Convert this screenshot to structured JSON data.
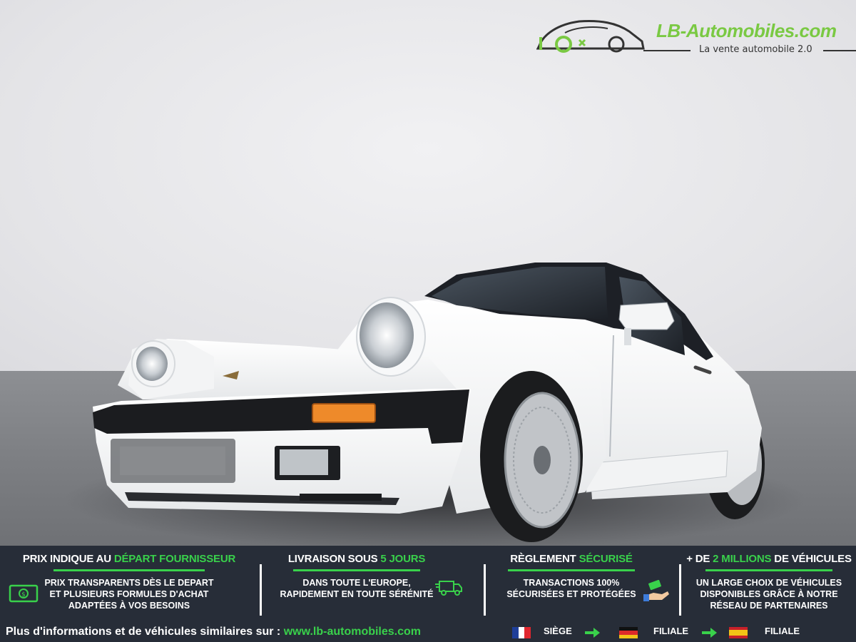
{
  "logo": {
    "name": "LB-Automobiles.com",
    "tagline": "La vente automobile 2.0",
    "accent": "#7ac943"
  },
  "features": [
    {
      "title_pre": "PRIX INDIQUE AU ",
      "title_hl": "DÉPART FOURNISSEUR",
      "title_post": "",
      "desc": "PRIX TRANSPARENTS DÈS LE DEPART\nET PLUSIEURS FORMULES D'ACHAT\nADAPTÉES À VOS BESOINS",
      "icon": "money-icon"
    },
    {
      "title_pre": "LIVRAISON SOUS ",
      "title_hl": "5 JOURS",
      "title_post": "",
      "desc": "DANS TOUTE L'EUROPE,\nRAPIDEMENT EN TOUTE SÉRÉNITÉ",
      "icon": "delivery-truck-icon"
    },
    {
      "title_pre": "RÈGLEMENT ",
      "title_hl": "SÉCURISÉ",
      "title_post": "",
      "desc": "TRANSACTIONS 100%\nSÉCURISÉES ET PROTÉGÉES",
      "icon": "payment-hand-icon"
    },
    {
      "title_pre": "+ DE ",
      "title_hl": "2 MILLIONS",
      "title_post": " DE VÉHICULES",
      "desc": "UN LARGE CHOIX DE VÉHICULES\nDISPONIBLES GRÂCE À NOTRE\nRÉSEAU DE PARTENAIRES",
      "icon": ""
    }
  ],
  "footer": {
    "text": "Plus d'informations et de véhicules similaires sur : ",
    "url": "www.lb-automobiles.com"
  },
  "network": [
    {
      "flag": "france-flag-icon",
      "label": "SIÈGE"
    },
    {
      "flag": "germany-flag-icon",
      "label": "FILIALE"
    },
    {
      "flag": "spain-flag-icon",
      "label": "FILIALE"
    }
  ],
  "colors": {
    "banner_bg": "#272d38",
    "highlight": "#39d14b"
  }
}
